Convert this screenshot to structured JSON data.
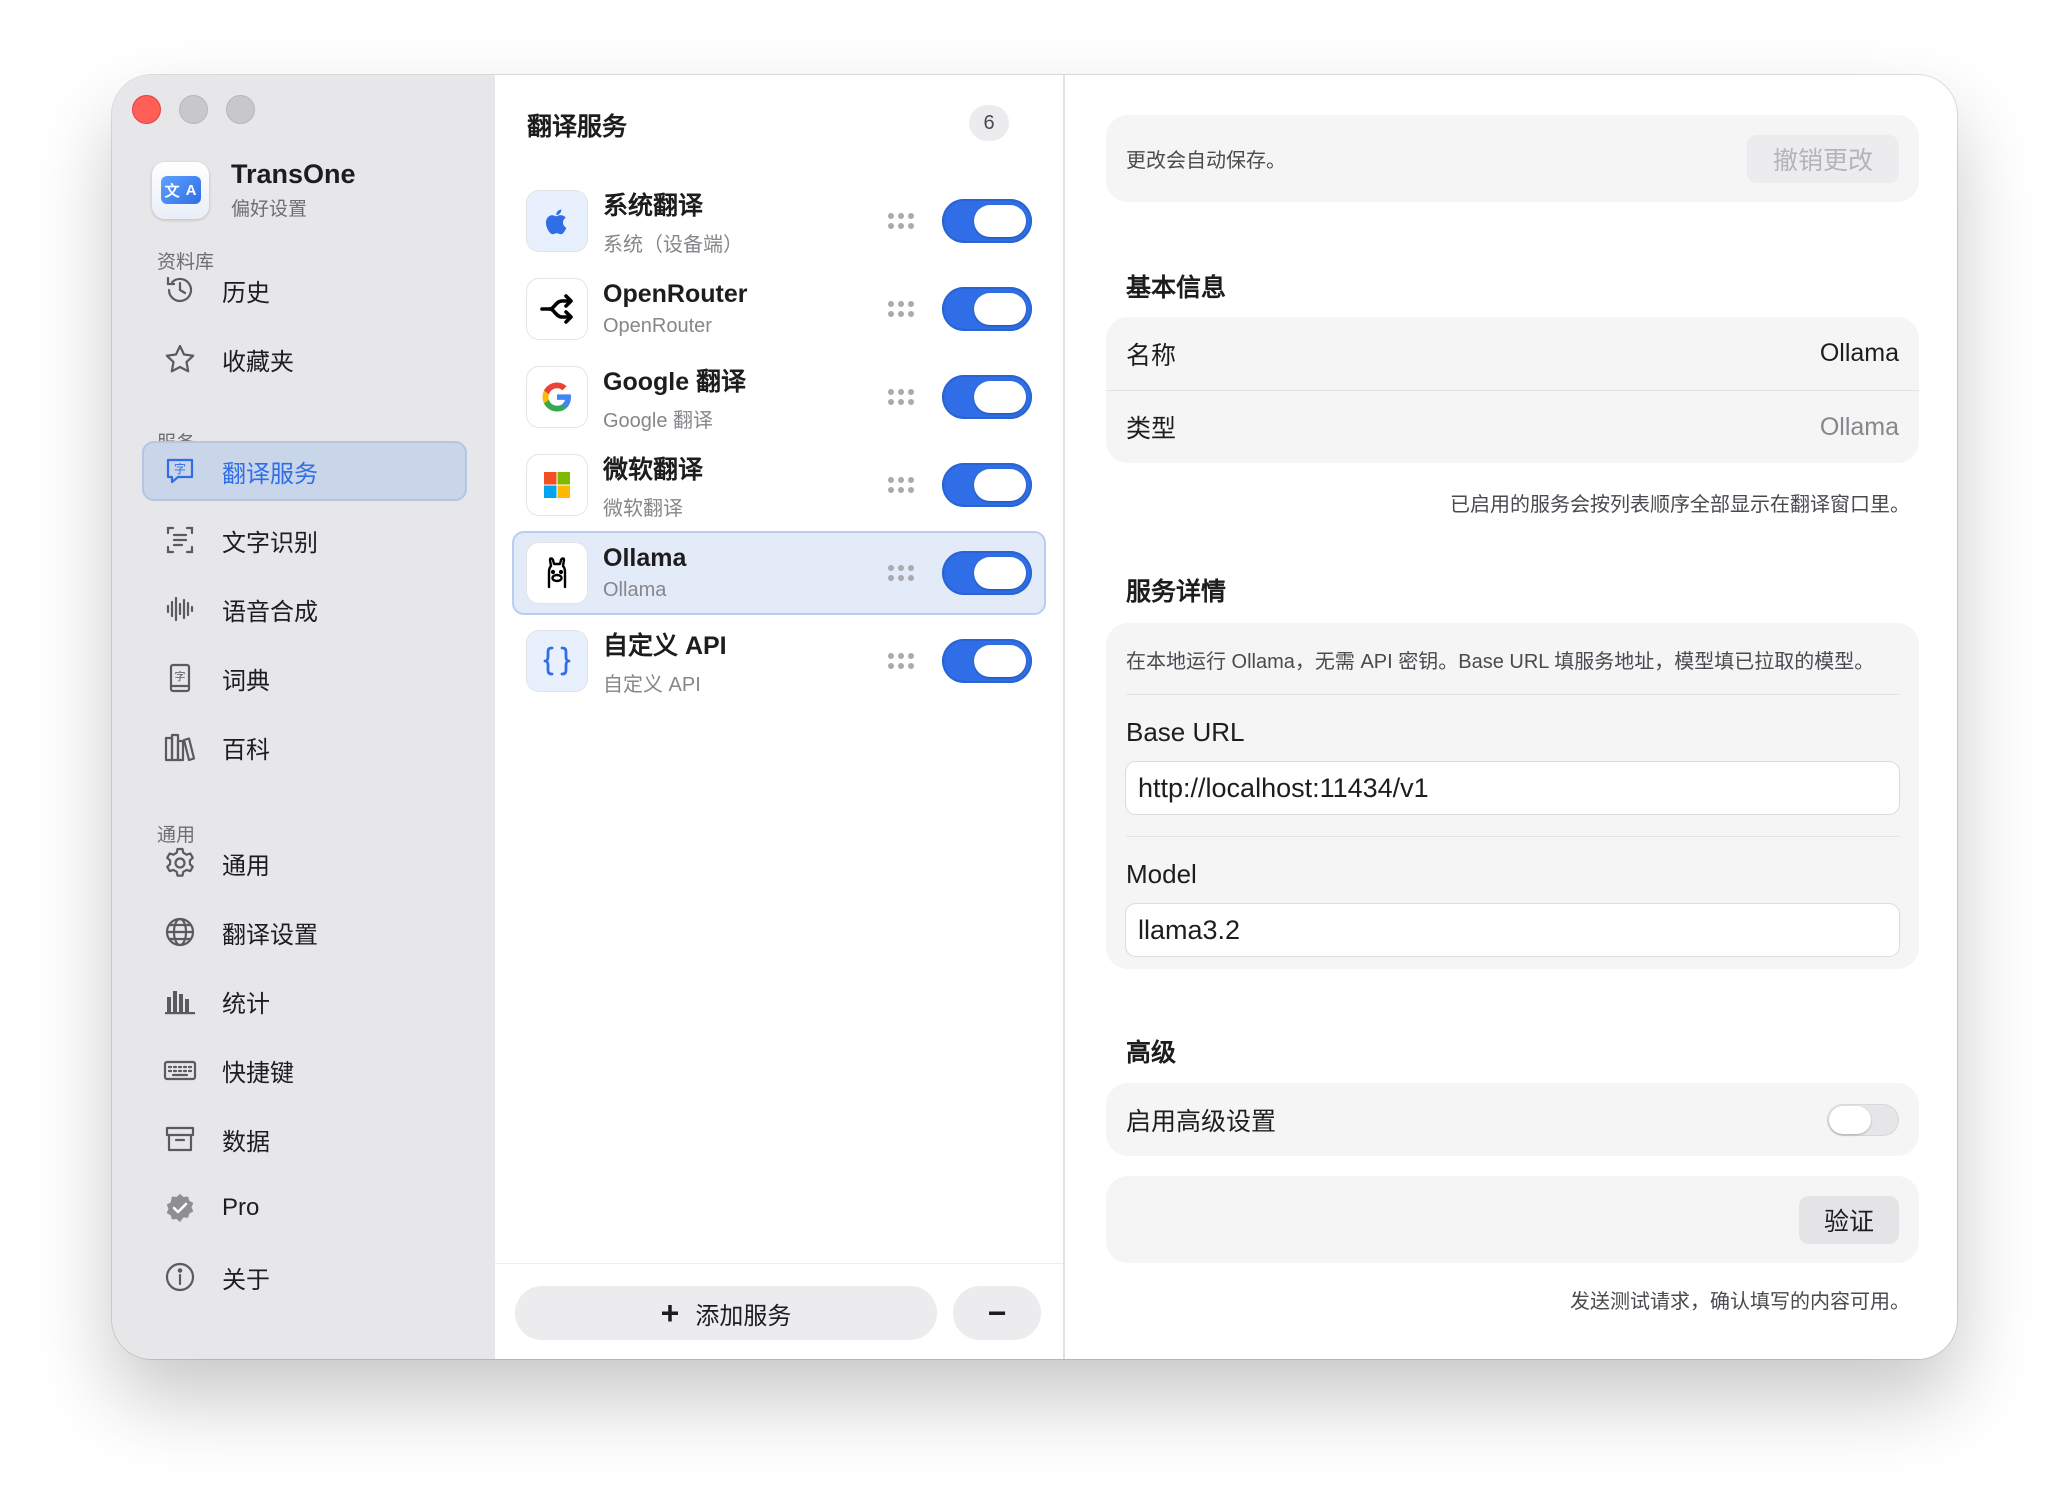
{
  "app": {
    "name": "TransOne",
    "subtitle": "偏好设置",
    "icon": "translate-app-icon"
  },
  "sidebar": {
    "sections": {
      "library": "资料库",
      "services": "服务",
      "general": "通用"
    },
    "items": [
      {
        "id": "history",
        "label": "历史",
        "icon": "clock-history-icon"
      },
      {
        "id": "favorites",
        "label": "收藏夹",
        "icon": "star-icon"
      },
      {
        "id": "translation-services",
        "label": "翻译服务",
        "icon": "translate-bubble-icon",
        "active": true
      },
      {
        "id": "ocr",
        "label": "文字识别",
        "icon": "text-scan-icon"
      },
      {
        "id": "tts",
        "label": "语音合成",
        "icon": "waveform-icon"
      },
      {
        "id": "dictionary",
        "label": "词典",
        "icon": "book-icon"
      },
      {
        "id": "encyclopedia",
        "label": "百科",
        "icon": "books-icon"
      },
      {
        "id": "general",
        "label": "通用",
        "icon": "gear-icon"
      },
      {
        "id": "translation-settings",
        "label": "翻译设置",
        "icon": "globe-icon"
      },
      {
        "id": "statistics",
        "label": "统计",
        "icon": "bar-chart-icon"
      },
      {
        "id": "shortcuts",
        "label": "快捷键",
        "icon": "keyboard-icon"
      },
      {
        "id": "data",
        "label": "数据",
        "icon": "archive-box-icon"
      },
      {
        "id": "pro",
        "label": "Pro",
        "icon": "verified-badge-icon"
      },
      {
        "id": "about",
        "label": "关于",
        "icon": "info-icon"
      }
    ]
  },
  "services_panel": {
    "title": "翻译服务",
    "count": "6",
    "services": [
      {
        "name": "系统翻译",
        "sub": "系统（设备端）",
        "icon": "apple-icon",
        "enabled": true
      },
      {
        "name": "OpenRouter",
        "sub": "OpenRouter",
        "icon": "openrouter-icon",
        "enabled": true
      },
      {
        "name": "Google 翻译",
        "sub": "Google 翻译",
        "icon": "google-icon",
        "enabled": true
      },
      {
        "name": "微软翻译",
        "sub": "微软翻译",
        "icon": "microsoft-icon",
        "enabled": true
      },
      {
        "name": "Ollama",
        "sub": "Ollama",
        "icon": "ollama-icon",
        "enabled": true,
        "selected": true
      },
      {
        "name": "自定义 API",
        "sub": "自定义 API",
        "icon": "braces-icon",
        "enabled": true
      }
    ],
    "add_label": "添加服务",
    "remove_label": "−"
  },
  "detail": {
    "autosave_msg": "更改会自动保存。",
    "revert_label": "撤销更改",
    "basic": {
      "title": "基本信息",
      "name_label": "名称",
      "name_value": "Ollama",
      "type_label": "类型",
      "type_value": "Ollama",
      "hint": "已启用的服务会按列表顺序全部显示在翻译窗口里。"
    },
    "service_details": {
      "title": "服务详情",
      "description": "在本地运行 Ollama，无需 API 密钥。Base URL 填服务地址，模型填已拉取的模型。",
      "base_url_label": "Base URL",
      "base_url_value": "http://localhost:11434/v1",
      "model_label": "Model",
      "model_value": "llama3.2"
    },
    "advanced": {
      "title": "高级",
      "toggle_label": "启用高级设置",
      "enabled": false
    },
    "verify_label": "验证",
    "verify_hint": "发送测试请求，确认填写的内容可用。"
  },
  "colors": {
    "accent": "#2f6ee6",
    "sidebar_bg": "#e7e7e9",
    "active_bg": "#c9d6ea"
  }
}
